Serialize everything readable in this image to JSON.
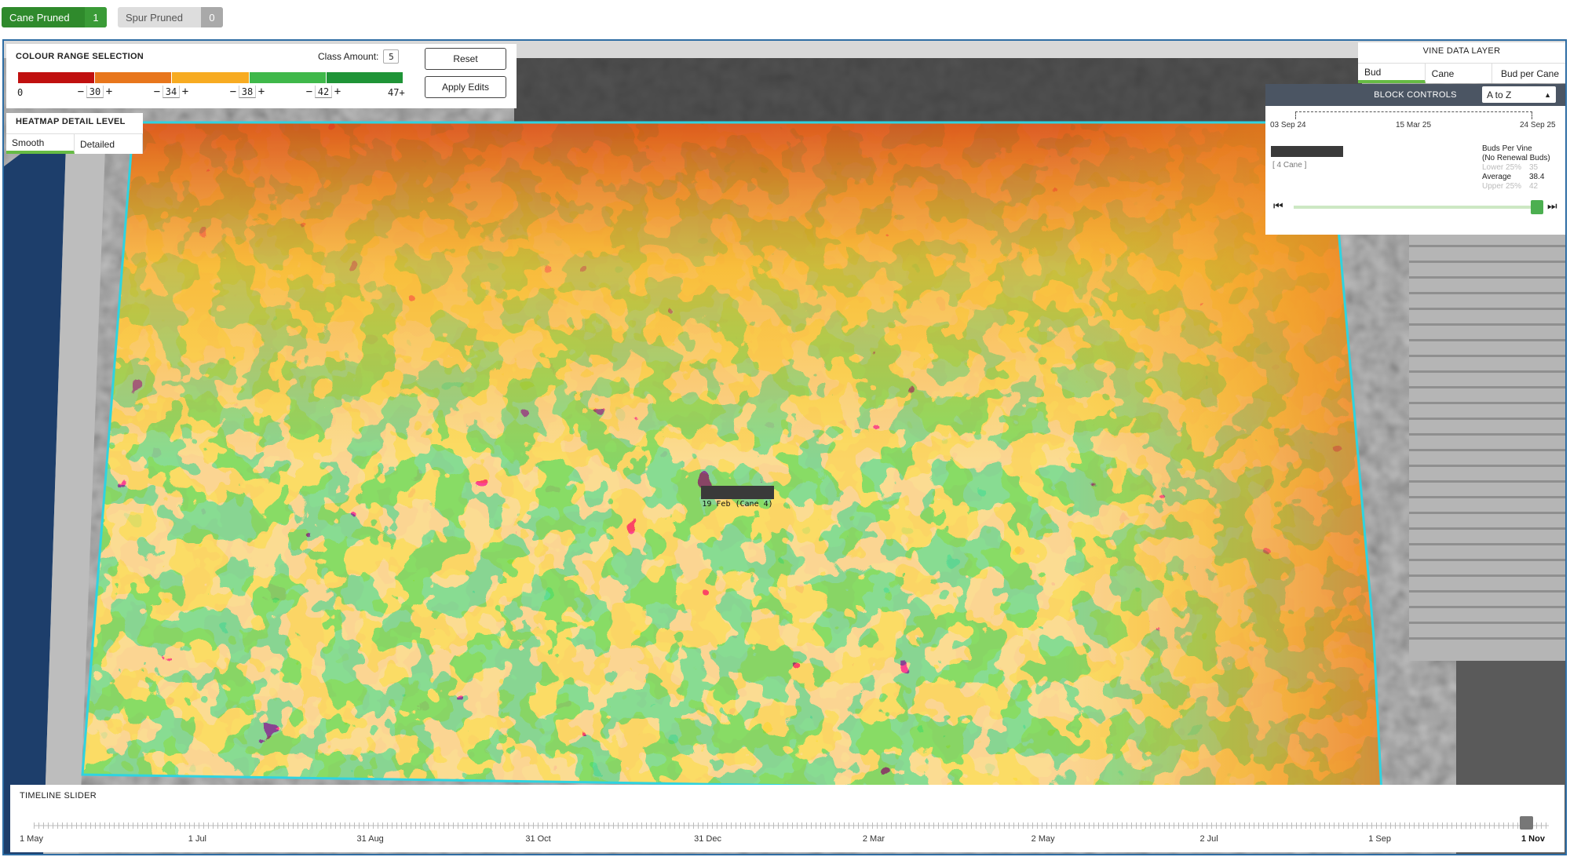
{
  "prune_toggles": {
    "cane": {
      "label": "Cane Pruned",
      "count": "1"
    },
    "spur": {
      "label": "Spur Pruned",
      "count": "0"
    }
  },
  "colour_range": {
    "title": "COLOUR RANGE SELECTION",
    "class_amount_label": "Class Amount:",
    "class_amount": "5",
    "colors": [
      "#c0100f",
      "#e8761c",
      "#f7ab21",
      "#3fb84a",
      "#1f9437"
    ],
    "min_label": "0",
    "max_label": "47+",
    "thresholds": [
      "30",
      "34",
      "38",
      "42"
    ],
    "reset_label": "Reset",
    "apply_label": "Apply Edits"
  },
  "heatmap_detail": {
    "title": "HEATMAP DETAIL LEVEL",
    "options": [
      "Smooth",
      "Detailed"
    ],
    "selected": "Smooth"
  },
  "vine_data_layer": {
    "title": "VINE DATA LAYER",
    "options": [
      "Bud",
      "Cane",
      "Bud per Cane"
    ],
    "selected": "Bud"
  },
  "block_controls": {
    "title": "BLOCK CONTROLS",
    "sort_value": "A to Z",
    "dates": [
      "03 Sep 24",
      "15 Mar 25",
      "24 Sep 25"
    ],
    "cane_label": "[ 4 Cane ]",
    "stats_title_1": "Buds Per Vine",
    "stats_title_2": "(No Renewal Buds)",
    "lower_label": "Lower 25%",
    "lower_value": "35",
    "average_label": "Average",
    "average_value": "38.4",
    "upper_label": "Upper 25%",
    "upper_value": "42",
    "slider_position": 1.0
  },
  "map_tooltip": {
    "text": "19 Feb (Cane 4)"
  },
  "timeline": {
    "title": "TIMELINE SLIDER",
    "labels": [
      "1 May",
      "1 Jul",
      "31 Aug",
      "31 Oct",
      "31 Dec",
      "2 Mar",
      "2 May",
      "2 Jul",
      "1 Sep",
      "1 Nov"
    ],
    "selected": "1 Nov",
    "position": 1.0
  }
}
